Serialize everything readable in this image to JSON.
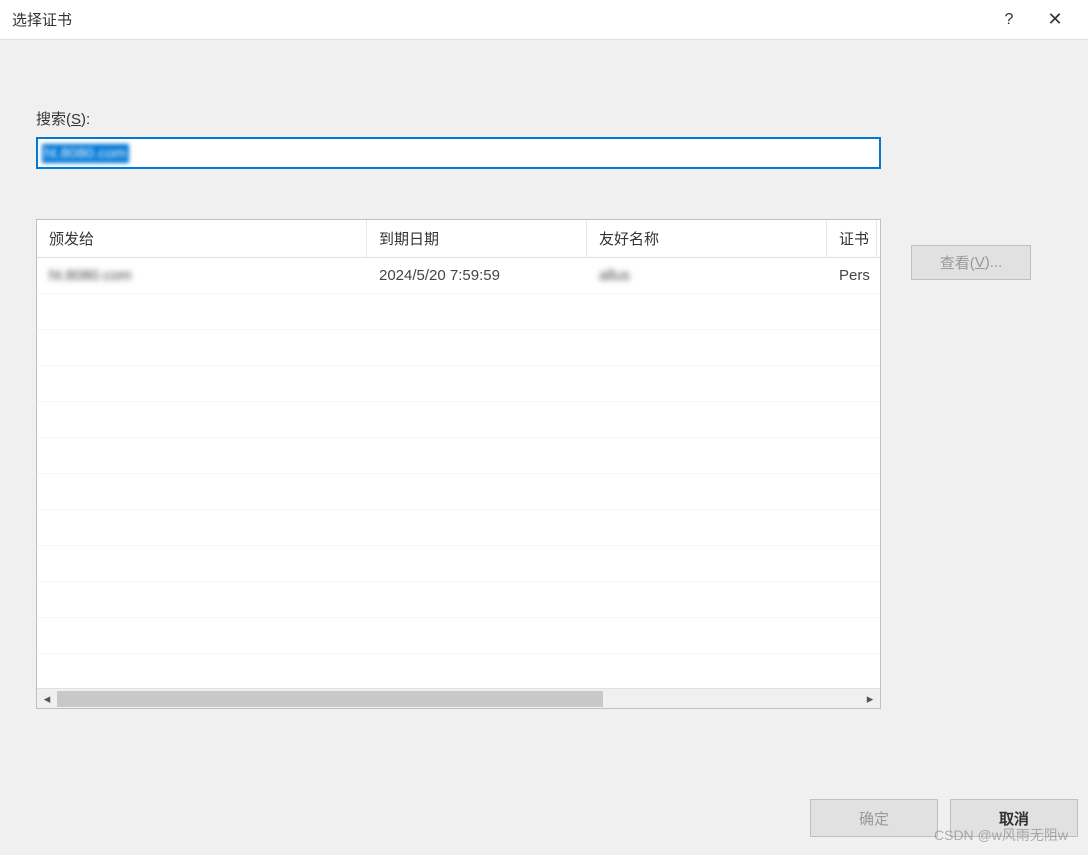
{
  "window": {
    "title": "选择证书"
  },
  "search": {
    "label_prefix": "搜索(",
    "label_key": "S",
    "label_suffix": "):",
    "value": "ht.8080.com"
  },
  "table": {
    "headers": [
      "颁发给",
      "到期日期",
      "友好名称",
      "证书"
    ],
    "rows": [
      {
        "issued_to": "ht.8080.com",
        "expires": "2024/5/20 7:59:59",
        "friendly_name": "allus",
        "cert": "Pers"
      }
    ]
  },
  "buttons": {
    "view_prefix": "查看(",
    "view_key": "V",
    "view_suffix": ")...",
    "ok": "确定",
    "cancel": "取消"
  },
  "watermark": "CSDN @w风雨无阻w"
}
